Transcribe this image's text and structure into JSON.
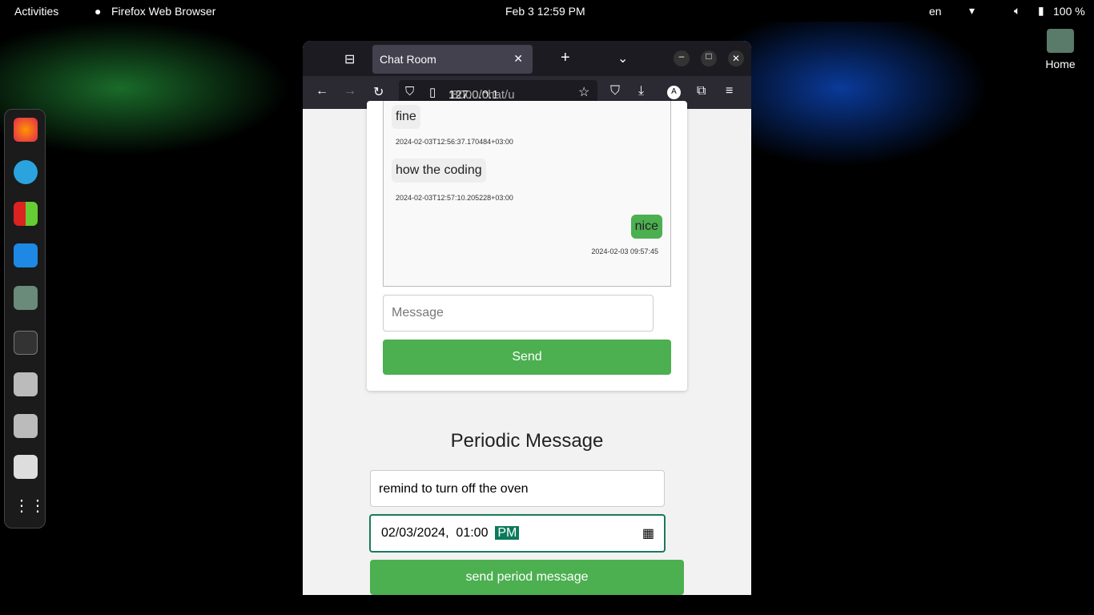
{
  "topbar": {
    "activities": "Activities",
    "app": "Firefox Web Browser",
    "clock": "Feb 3  12:59 PM",
    "lang": "en",
    "battery": "100 %"
  },
  "desktop": {
    "home_label": "Home"
  },
  "browser": {
    "tab_title": "Chat Room",
    "url_host": "127.0.0.1",
    "url_rest": ":8000/chat/u"
  },
  "chat": {
    "messages": [
      {
        "text": "fine",
        "time": "2024-02-03T12:56:37.170484+03:00",
        "mine": false
      },
      {
        "text": "how the coding",
        "time": "2024-02-03T12:57:10.205228+03:00",
        "mine": false
      },
      {
        "text": "nice",
        "time": "2024-02-03 09:57:45",
        "mine": true
      }
    ],
    "input_placeholder": "Message",
    "send_label": "Send"
  },
  "periodic": {
    "title": "Periodic Message",
    "message_value": "remind to turn off the oven",
    "date": "02/03/2024,",
    "time": "01:00",
    "ampm": "PM",
    "button_label": "send period message"
  },
  "colors": {
    "accent": "#4caf50"
  }
}
